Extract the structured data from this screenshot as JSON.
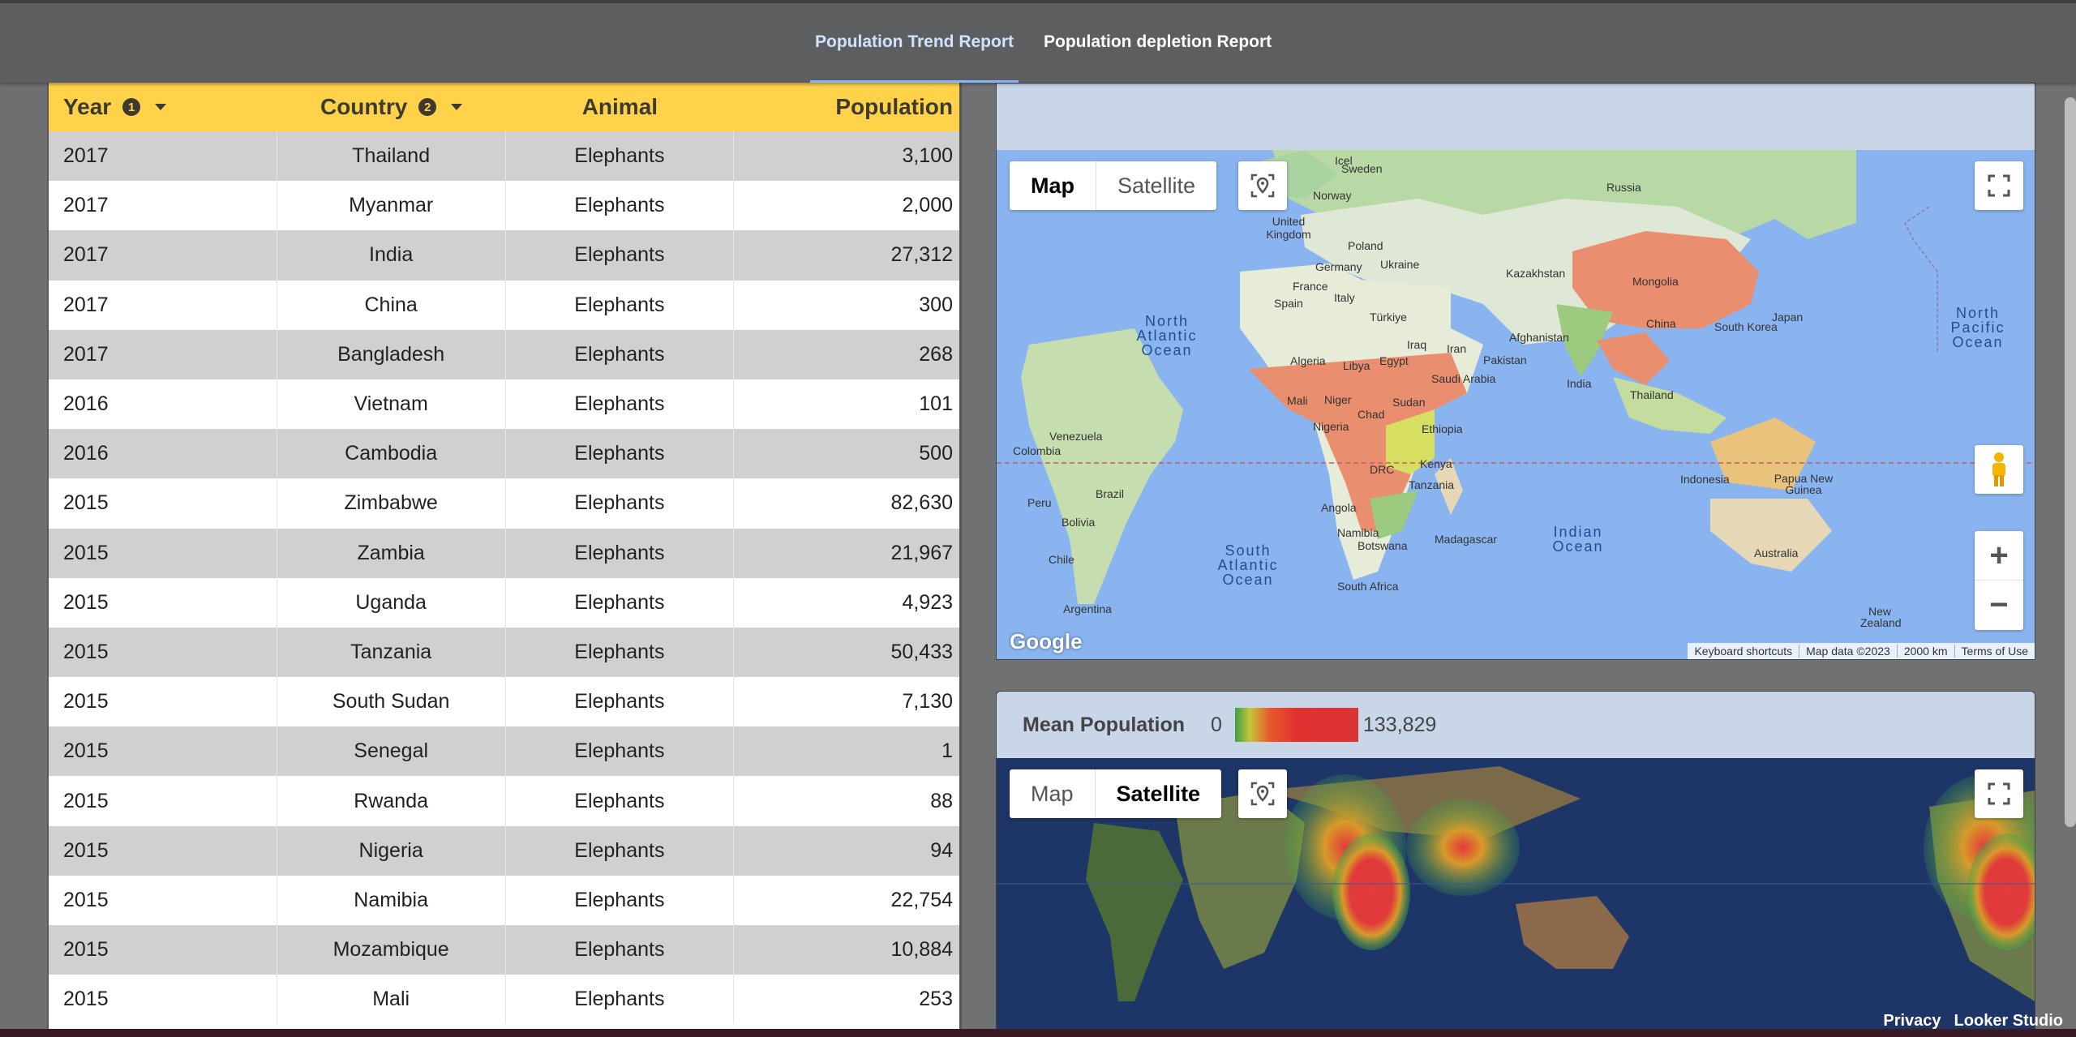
{
  "tabs": [
    {
      "label": "Population Trend Report",
      "active": true
    },
    {
      "label": "Population depletion Report",
      "active": false
    }
  ],
  "table": {
    "headers": {
      "year": "Year",
      "year_sort": "1",
      "country": "Country",
      "country_sort": "2",
      "animal": "Animal",
      "population": "Population"
    },
    "rows": [
      {
        "year": "2017",
        "country": "Thailand",
        "animal": "Elephants",
        "population": "3,100"
      },
      {
        "year": "2017",
        "country": "Myanmar",
        "animal": "Elephants",
        "population": "2,000"
      },
      {
        "year": "2017",
        "country": "India",
        "animal": "Elephants",
        "population": "27,312"
      },
      {
        "year": "2017",
        "country": "China",
        "animal": "Elephants",
        "population": "300"
      },
      {
        "year": "2017",
        "country": "Bangladesh",
        "animal": "Elephants",
        "population": "268"
      },
      {
        "year": "2016",
        "country": "Vietnam",
        "animal": "Elephants",
        "population": "101"
      },
      {
        "year": "2016",
        "country": "Cambodia",
        "animal": "Elephants",
        "population": "500"
      },
      {
        "year": "2015",
        "country": "Zimbabwe",
        "animal": "Elephants",
        "population": "82,630"
      },
      {
        "year": "2015",
        "country": "Zambia",
        "animal": "Elephants",
        "population": "21,967"
      },
      {
        "year": "2015",
        "country": "Uganda",
        "animal": "Elephants",
        "population": "4,923"
      },
      {
        "year": "2015",
        "country": "Tanzania",
        "animal": "Elephants",
        "population": "50,433"
      },
      {
        "year": "2015",
        "country": "South Sudan",
        "animal": "Elephants",
        "population": "7,130"
      },
      {
        "year": "2015",
        "country": "Senegal",
        "animal": "Elephants",
        "population": "1"
      },
      {
        "year": "2015",
        "country": "Rwanda",
        "animal": "Elephants",
        "population": "88"
      },
      {
        "year": "2015",
        "country": "Nigeria",
        "animal": "Elephants",
        "population": "94"
      },
      {
        "year": "2015",
        "country": "Namibia",
        "animal": "Elephants",
        "population": "22,754"
      },
      {
        "year": "2015",
        "country": "Mozambique",
        "animal": "Elephants",
        "population": "10,884"
      },
      {
        "year": "2015",
        "country": "Mali",
        "animal": "Elephants",
        "population": "253"
      }
    ]
  },
  "map1": {
    "type_map": "Map",
    "type_satellite": "Satellite",
    "selected": "Map",
    "google": "Google",
    "attribution": [
      "Keyboard shortcuts",
      "Map data ©2023",
      "2000 km",
      "Terms of Use"
    ],
    "labels": {
      "sweden": "Sweden",
      "norway": "Norway",
      "russia": "Russia",
      "uk": "United Kingdom",
      "poland": "Poland",
      "germany": "Germany",
      "ukraine": "Ukraine",
      "france": "France",
      "kazakhstan": "Kazakhstan",
      "mongolia": "Mongolia",
      "spain": "Spain",
      "italy": "Italy",
      "turkiye": "Türkiye",
      "china": "China",
      "southkorea": "South Korea",
      "japan": "Japan",
      "afghanistan": "Afghanistan",
      "iraq": "Iraq",
      "iran": "Iran",
      "pakistan": "Pakistan",
      "algeria": "Algeria",
      "libya": "Libya",
      "egypt": "Egypt",
      "saudi": "Saudi Arabia",
      "india": "India",
      "thailand": "Thailand",
      "mali": "Mali",
      "niger": "Niger",
      "chad": "Chad",
      "sudan": "Sudan",
      "nigeria": "Nigeria",
      "ethiopia": "Ethiopia",
      "venezuela": "Venezuela",
      "colombia": "Colombia",
      "drc": "DRC",
      "kenya": "Kenya",
      "tanzania": "Tanzania",
      "indonesia": "Indonesia",
      "png": "Papua New Guinea",
      "peru": "Peru",
      "brazil": "Brazil",
      "angola": "Angola",
      "bolivia": "Bolivia",
      "namibia": "Namibia",
      "botswana": "Botswana",
      "madagascar": "Madagascar",
      "australia": "Australia",
      "chile": "Chile",
      "southafrica": "South Africa",
      "argentina": "Argentina",
      "newzealand": "New Zealand",
      "iceland": "Icel"
    },
    "oceans": {
      "north_atlantic": "North Atlantic Ocean",
      "north_pacific": "North Pacific Ocean",
      "south_atlantic": "South Atlantic Ocean",
      "indian": "Indian Ocean"
    }
  },
  "map2": {
    "legend_title": "Mean Population",
    "legend_min": "0",
    "legend_max": "133,829",
    "type_map": "Map",
    "type_satellite": "Satellite",
    "selected": "Satellite"
  },
  "footer": {
    "privacy": "Privacy",
    "looker": "Looker Studio"
  }
}
